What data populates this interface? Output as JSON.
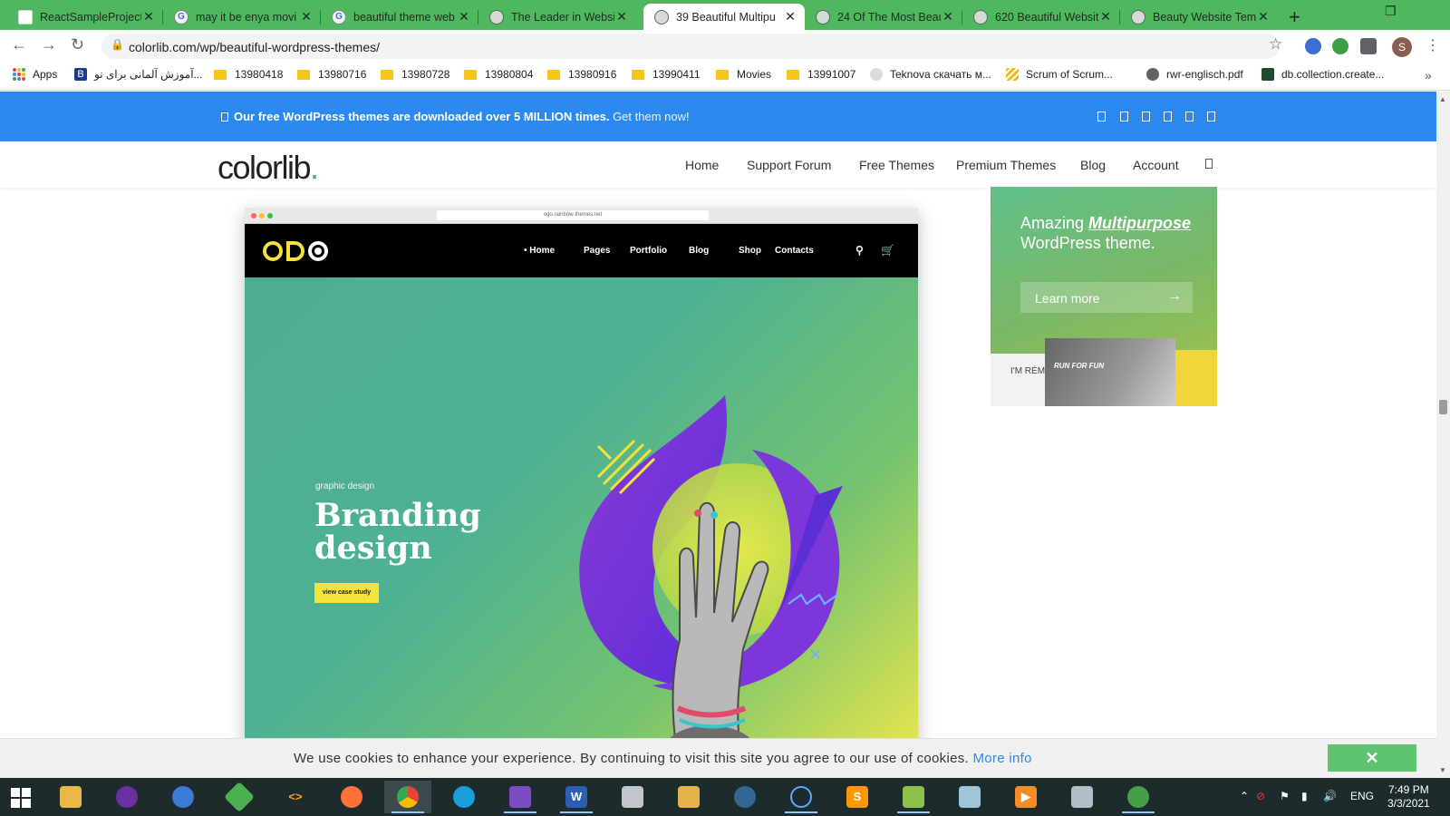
{
  "browser": {
    "tabs": [
      {
        "label": "ReactSampleProject",
        "icon": "document-icon"
      },
      {
        "label": "may it be enya movi",
        "icon": "google-icon"
      },
      {
        "label": "beautiful theme web",
        "icon": "google-icon"
      },
      {
        "label": "The Leader in Websi",
        "icon": "globe-icon"
      },
      {
        "label": "39 Beautiful Multipu",
        "icon": "globe-icon",
        "active": true
      },
      {
        "label": "24 Of The Most Beau",
        "icon": "globe-icon"
      },
      {
        "label": "620 Beautiful Websit",
        "icon": "globe-icon"
      },
      {
        "label": "Beauty Website Tem",
        "icon": "globe-icon"
      }
    ],
    "url": "colorlib.com/wp/beautiful-wordpress-themes/",
    "profile_initial": "S",
    "bookmarks": [
      {
        "label": "Apps",
        "type": "apps"
      },
      {
        "label": "آموزش آلمانی برای نو...",
        "type": "site"
      },
      {
        "label": "13980418",
        "type": "folder"
      },
      {
        "label": "13980716",
        "type": "folder"
      },
      {
        "label": "13980728",
        "type": "folder"
      },
      {
        "label": "13980804",
        "type": "folder"
      },
      {
        "label": "13980916",
        "type": "folder"
      },
      {
        "label": "13990411",
        "type": "folder"
      },
      {
        "label": "Movies",
        "type": "folder"
      },
      {
        "label": "13991007",
        "type": "folder"
      },
      {
        "label": "Teknova скачать м...",
        "type": "site"
      },
      {
        "label": "Scrum of Scrum...",
        "type": "site"
      },
      {
        "label": "rwr-englisch.pdf",
        "type": "site"
      },
      {
        "label": "db.collection.create...",
        "type": "site"
      }
    ]
  },
  "page": {
    "promo": {
      "bold": "Our free WordPress themes are downloaded over 5 MILLION times.",
      "link": "Get them now!"
    },
    "logo": "colorlib",
    "nav": [
      "Home",
      "Support Forum",
      "Free Themes",
      "Premium Themes",
      "Blog",
      "Account"
    ],
    "theme_preview": {
      "url": "ogo.rainbow-themes.net",
      "nav": [
        "• Home",
        "Pages",
        "Portfolio",
        "Blog",
        "Shop",
        "Contacts"
      ],
      "kicker": "graphic design",
      "title_line1": "Branding",
      "title_line2": "design",
      "cta": "view case study"
    },
    "ad": {
      "line1_prefix": "Amazing",
      "line1_emph": "Multipurpose",
      "line2": "WordPress theme.",
      "button": "Learn more",
      "img_caption": "RUN FOR FUN",
      "img_caption2": "I'M RÉMI"
    },
    "cookie": {
      "text": "We use cookies to enhance your experience. By continuing to visit this site you agree to our use of cookies.",
      "link": "More info",
      "close": "✕"
    }
  },
  "taskbar": {
    "lang": "ENG",
    "time": "7:49 PM",
    "date": "3/3/2021"
  },
  "colors": {
    "tab_strip": "#4fb85e",
    "promo_bar": "#2c89f0",
    "hero_teal": "#4fae92",
    "hero_yellow": "#f0e84a",
    "cookie_close": "#5fc472"
  }
}
